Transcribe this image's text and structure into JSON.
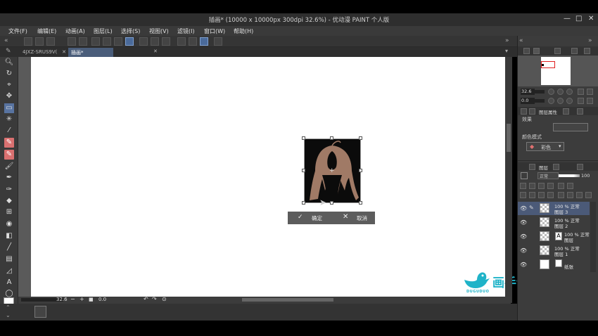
{
  "window": {
    "title": "插画* (10000 x 10000px 300dpi 32.6%) - 优动漫 PAINT 个人版",
    "minimize": "—",
    "maximize": "□",
    "close": "✕"
  },
  "menu": [
    "文件(F)",
    "编辑(E)",
    "动画(A)",
    "图层(L)",
    "选择(S)",
    "视图(V)",
    "滤镜(I)",
    "窗口(W)",
    "帮助(H)"
  ],
  "tabs": [
    {
      "label": "4JXZ-SRUS9V(",
      "close": "✕"
    },
    {
      "label": "插画*",
      "close": "✕"
    }
  ],
  "transform": {
    "ok_label": "确定",
    "cancel_label": "取消"
  },
  "status": {
    "zoom": "32.6",
    "angle": "0.0"
  },
  "navigator": {
    "zoom": "32.6",
    "angle": "0.0"
  },
  "sub_tool_detail": {
    "tab_label": "图层属性",
    "effect_label": "效果",
    "color_mode_label": "颜色模式",
    "color_mode_value": "彩色"
  },
  "layer_panel": {
    "tab_label": "图层",
    "blend_mode": "正常",
    "opacity": "100",
    "layers": [
      {
        "line1": "100 % 正常",
        "line2": "图层 3",
        "type": "raster",
        "selected": true
      },
      {
        "line1": "100 % 正常",
        "line2": "图层 2",
        "type": "raster",
        "selected": false
      },
      {
        "line1": "100 % 正常",
        "line2": "图层",
        "type": "text",
        "selected": false
      },
      {
        "line1": "100 % 正常",
        "line2": "图层 1",
        "type": "raster",
        "selected": false
      },
      {
        "line1": "纸张",
        "line2": "",
        "type": "paper",
        "selected": false
      }
    ]
  },
  "watermark": {
    "text": "画手请就位",
    "sub": "DUGUDUO",
    "color": "#1fb3c8"
  },
  "colors": {
    "accent": "#4b5a78",
    "tool_highlight": "#d97070"
  }
}
